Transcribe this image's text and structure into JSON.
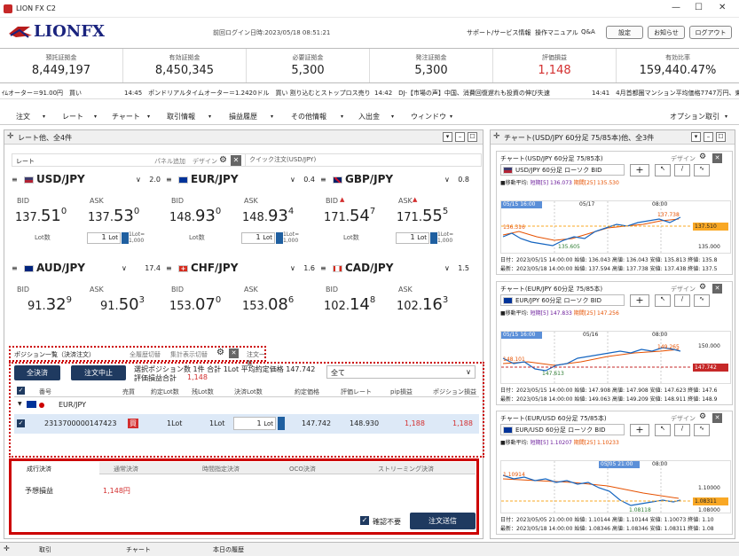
{
  "app": {
    "title": "LION FX C2",
    "logo": "LIONFX",
    "last_login": "前回ログイン日時:2023/05/18 08:51:21"
  },
  "header": {
    "links": [
      "サポート/サービス情報",
      "操作マニュアル",
      "Q&A"
    ],
    "buttons": [
      "設定",
      "お知らせ",
      "ログアウト"
    ]
  },
  "summary": [
    {
      "label": "預託証拠金",
      "value": "8,449,197"
    },
    {
      "label": "有効証拠金",
      "value": "8,450,345"
    },
    {
      "label": "必要証拠金",
      "value": "5,300"
    },
    {
      "label": "発注証拠金",
      "value": "5,300"
    },
    {
      "label": "評価損益",
      "value": "1,148"
    },
    {
      "label": "有効比率",
      "value": "159,440.47%"
    }
  ],
  "ticker": [
    "ｲﾑオーター＝91.00円　買い",
    "14:45　ポンドリアルタイムオーター＝1.2420ドル　買い 割り込むとストップロス売り",
    "14:42　DJ-【市場の声】中国、消費回復遅れも投資の伸び失速",
    "14:41　4月首都圏マンション平均価格7747万円、東"
  ],
  "menu": [
    "注文",
    "レート",
    "チャート",
    "取引情報",
    "損益履歴",
    "その他情報",
    "入出金",
    "ウィンドウ",
    "オプション取引"
  ],
  "rate_panel": {
    "title": "レート他、全4件",
    "tab": "レート",
    "links": [
      "パネル追加",
      "デザイン"
    ],
    "quick_order": "クイック注文(USD/JPY)"
  },
  "rates": [
    {
      "pair": "USD/JPY",
      "spread": "2.0",
      "bid_label": "BID",
      "ask_label": "ASK",
      "bid_a": "137.",
      "bid_b": "51",
      "bid_c": "0",
      "ask_a": "137.",
      "ask_b": "53",
      "ask_c": "0",
      "lot_label": "Lot数",
      "lot": "1",
      "lot_unit": "Lot",
      "lot_sub": "1Lot=\n1,000",
      "flag": "us"
    },
    {
      "pair": "EUR/JPY",
      "spread": "0.4",
      "bid_label": "BID",
      "ask_label": "ASK",
      "bid_a": "148.",
      "bid_b": "93",
      "bid_c": "0",
      "ask_a": "148.",
      "ask_b": "93",
      "ask_c": "4",
      "lot_label": "Lot数",
      "lot": "1",
      "lot_unit": "Lot",
      "lot_sub": "1Lot=\n1,000",
      "flag": "eu"
    },
    {
      "pair": "GBP/JPY",
      "spread": "0.8",
      "bid_label": "BID",
      "ask_label": "ASK",
      "bid_a": "171.",
      "bid_b": "54",
      "bid_c": "7",
      "ask_a": "171.",
      "ask_b": "55",
      "ask_c": "5",
      "lot_label": "Lot数",
      "lot": "1",
      "lot_unit": "Lot",
      "lot_sub": "1Lot=\n1,000",
      "flag": "gb"
    },
    {
      "pair": "AUD/JPY",
      "spread": "17.4",
      "bid_label": "BID",
      "ask_label": "ASK",
      "bid_a": "91.",
      "bid_b": "32",
      "bid_c": "9",
      "ask_a": "91.",
      "ask_b": "50",
      "ask_c": "3",
      "lot_label": "Lot数",
      "lot": "1",
      "lot_unit": "Lot",
      "lot_sub": "1Lot=\n1,000",
      "flag": "au"
    },
    {
      "pair": "CHF/JPY",
      "spread": "1.6",
      "bid_label": "BID",
      "ask_label": "ASK",
      "bid_a": "153.",
      "bid_b": "07",
      "bid_c": "0",
      "ask_a": "153.",
      "ask_b": "08",
      "ask_c": "6",
      "lot_label": "Lot数",
      "lot": "1",
      "lot_unit": "Lot",
      "lot_sub": "1Lot=\n1,000",
      "flag": "ch"
    },
    {
      "pair": "CAD/JPY",
      "spread": "1.5",
      "bid_label": "BID",
      "ask_label": "ASK",
      "bid_a": "102.",
      "bid_b": "14",
      "bid_c": "8",
      "ask_a": "102.",
      "ask_b": "16",
      "ask_c": "3",
      "lot_label": "Lot数",
      "lot": "1",
      "lot_unit": "Lot",
      "lot_sub": "1Lot=\n1,000",
      "flag": "ca"
    }
  ],
  "positions": {
    "tabs": [
      "ポジション一覧（決済注文）",
      "全履歴切替",
      "集計表示切替",
      "注文一覧"
    ],
    "btn_all": "全決済",
    "btn_stop": "注文中止",
    "summary1": "選択ポジション数 1件  合計 1Lot 平均約定価格 147.742",
    "summary2_label": "評価損益合計",
    "summary2_value": "1,148",
    "filter": "全て",
    "columns": [
      "番号",
      "売買",
      "約定Lot数",
      "残Lot数",
      "決済Lot数",
      "約定価格",
      "評価レート",
      "pip損益",
      "ポジション損益"
    ],
    "group": "EUR/JPY",
    "row": {
      "id": "2313700000147423",
      "side": "買",
      "lot": "1Lot",
      "remain": "1Lot",
      "close_lot": "1",
      "close_unit": "Lot",
      "price": "147.742",
      "rate": "148.930",
      "pip": "1,188",
      "pl": "1,188"
    }
  },
  "order": {
    "tabs": [
      "成行決済",
      "通常決済",
      "時間指定決済",
      "OCO決済",
      "ストリーミング決済"
    ],
    "expected_label": "予想損益",
    "expected_value": "1,148円",
    "no_confirm": "確認不要",
    "send": "注文送信"
  },
  "chart_panel": {
    "title": "チャート(USD/JPY 60分足 75/85本)他、全3件"
  },
  "charts": [
    {
      "title": "チャート(USD/JPY 60分足 75/85本)",
      "design": "デザイン",
      "pair": "USD/JPY 60分足 ローソク BID",
      "ma": "■移動平均:",
      "ma1": "短期[5] 136.073",
      "ma2": "期間[25] 135.530",
      "dates": [
        "05/15 16:00",
        "05/17",
        "08:00"
      ],
      "last": "137.510",
      "y1": "137.738",
      "y2": "136.316",
      "y3": "135.605",
      "axis": "135.000",
      "info1": "日付：2023/05/15 14:00:00 始値: 136.043 高値: 136.043 安値: 135.813 終値: 135.8",
      "info2": "最新：2023/05/18 14:00:00 始値: 137.594 高値: 137.738 安値: 137.438 終値: 137.5"
    },
    {
      "title": "チャート(EUR/JPY 60分足 75/85本)",
      "design": "デザイン",
      "pair": "EUR/JPY 60分足 ローソク BID",
      "ma": "■移動平均:",
      "ma1": "短期[5] 147.833",
      "ma2": "期間[25] 147.256",
      "dates": [
        "05/15 16:00",
        "05/16",
        "08:00"
      ],
      "last": "148.930",
      "y1": "149.265",
      "y2": "148.101",
      "y3": "147.613",
      "axis": "150.000",
      "mark": "147.742",
      "info1": "日付：2023/05/15 14:00:00 始値: 147.908 高値: 147.908 安値: 147.623 終値: 147.6",
      "info2": "最新：2023/05/18 14:00:00 始値: 149.063 高値: 149.209 安値: 148.911 終値: 148.9"
    },
    {
      "title": "チャート(EUR/USD 60分足 75/85本)",
      "design": "デザイン",
      "pair": "EUR/USD 60分足 ローソク BID",
      "ma": "■移動平均:",
      "ma1": "短期[5] 1.10207",
      "ma2": "期間[25] 1.10233",
      "dates": [
        "05/05 21:00",
        "08:00"
      ],
      "last": "1.08311",
      "y1": "1.10914",
      "y2": "1.08118",
      "axis": "1.10000",
      "axis2": "1.08000",
      "info1": "日付：2023/05/05 21:00:00 始値: 1.10144 高値: 1.10144 安値: 1.10073 終値: 1.10",
      "info2": "最新：2023/05/18 14:00:00 始値: 1.08346 高値: 1.08346 安値: 1.08311 終値: 1.08"
    }
  ],
  "bottom": [
    "取引",
    "チャート",
    "本日の履歴"
  ]
}
